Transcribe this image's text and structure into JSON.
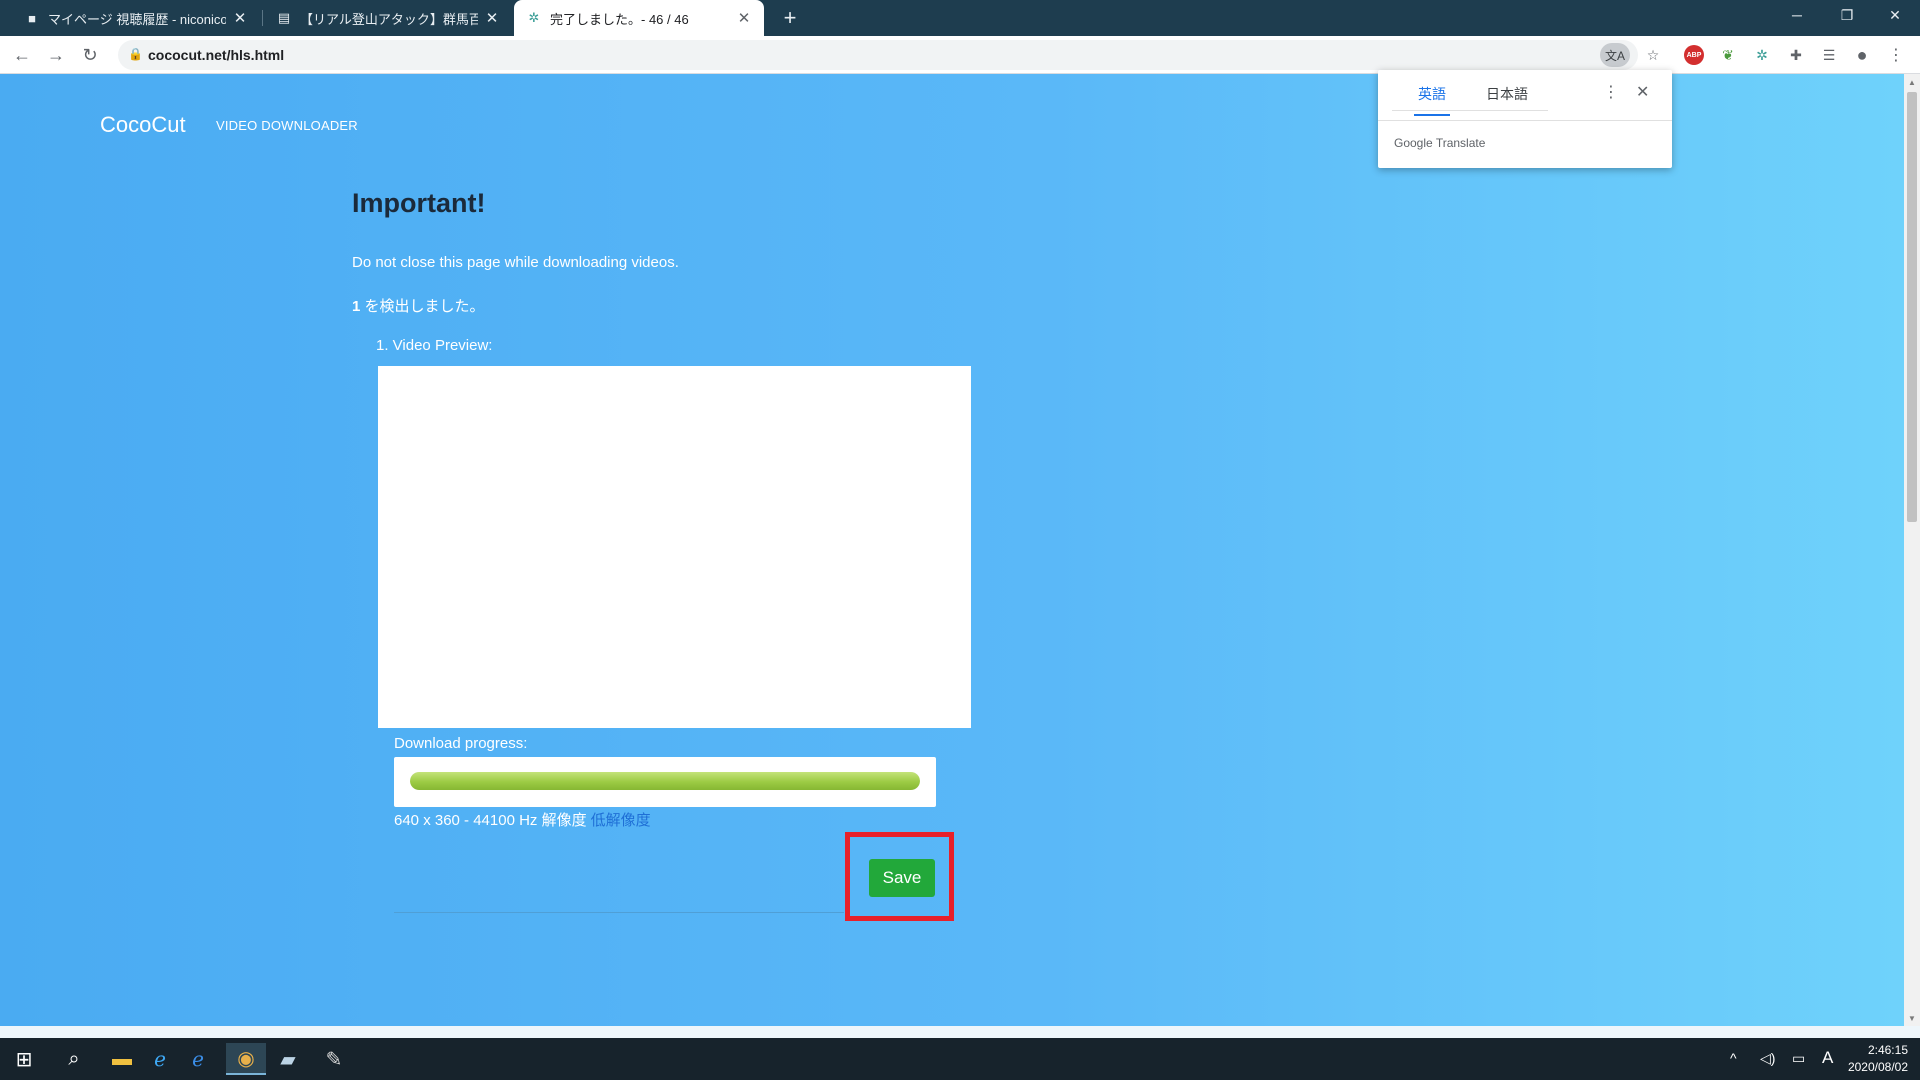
{
  "browser": {
    "tabs": [
      {
        "title": "マイページ 視聴履歴 - niconico(",
        "favicon": "niconico-icon",
        "active": false
      },
      {
        "title": "【リアル登山アタック】群馬百名山",
        "favicon": "video-icon",
        "active": false
      },
      {
        "title": "完了しました。- 46 / 46",
        "favicon": "cococut-icon",
        "active": true
      }
    ],
    "new_tab_label": "+",
    "window_controls": {
      "minimize": "─",
      "restore": "❐",
      "close": "✕"
    },
    "url": "cococut.net/hls.html"
  },
  "translate_popup": {
    "source_lang": "英語",
    "target_lang": "日本語",
    "brand": "Google Translate"
  },
  "page": {
    "brand": "CocoCut",
    "brand_subtitle": "VIDEO DOWNLOADER",
    "heading": "Important!",
    "warning": "Do not close this page while downloading videos.",
    "detected_count": "1",
    "detected_suffix": " を検出しました。",
    "preview_label": "1. Video Preview:",
    "progress_label": "Download progress:",
    "progress_value": 100,
    "resolution_text": "640 x 360 - 44100 Hz 解像度",
    "resolution_low": "低解像度",
    "save_label": "Save"
  },
  "taskbar": {
    "clock_time": "2:46:15",
    "clock_date": "2020/08/02",
    "ime": "A"
  },
  "colors": {
    "save_button": "#22a83a",
    "highlight": "#e8202a",
    "progress_fill": "#9ccb44",
    "page_gradient_start": "#4aabf2",
    "page_gradient_end": "#6fd2fb"
  }
}
